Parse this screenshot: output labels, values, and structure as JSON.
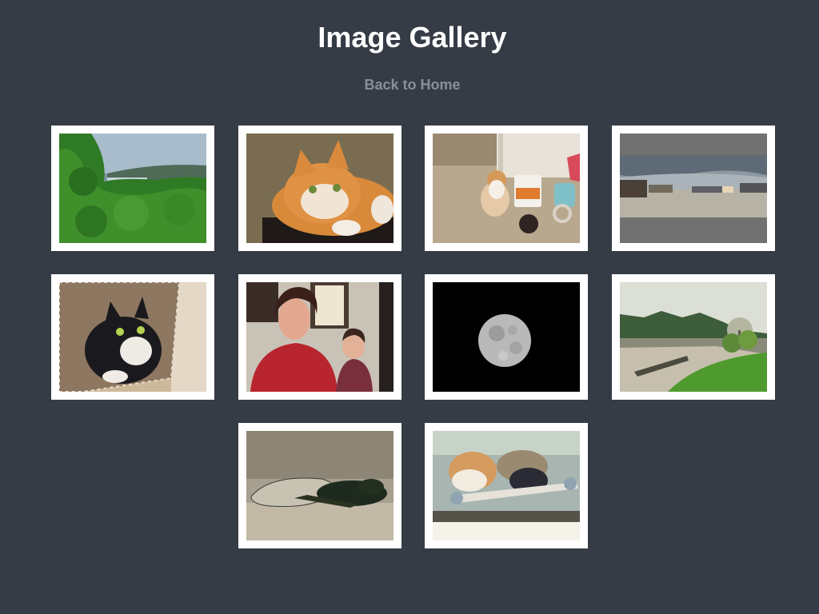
{
  "page": {
    "title": "Image Gallery",
    "back_link": "Back to Home"
  },
  "colors": {
    "background": "#363c46",
    "title": "#ffffff",
    "link": "#8a8f96",
    "frame": "#ffffff"
  },
  "gallery": {
    "images": [
      {
        "name": "thumbnail-forest-lake"
      },
      {
        "name": "thumbnail-orange-cat"
      },
      {
        "name": "thumbnail-cat-kitchen"
      },
      {
        "name": "thumbnail-panorama"
      },
      {
        "name": "thumbnail-black-white-cat-basket"
      },
      {
        "name": "thumbnail-woman-and-boy"
      },
      {
        "name": "thumbnail-full-moon"
      },
      {
        "name": "thumbnail-mountain-field"
      },
      {
        "name": "thumbnail-cicada"
      },
      {
        "name": "thumbnail-cats-window"
      }
    ]
  }
}
